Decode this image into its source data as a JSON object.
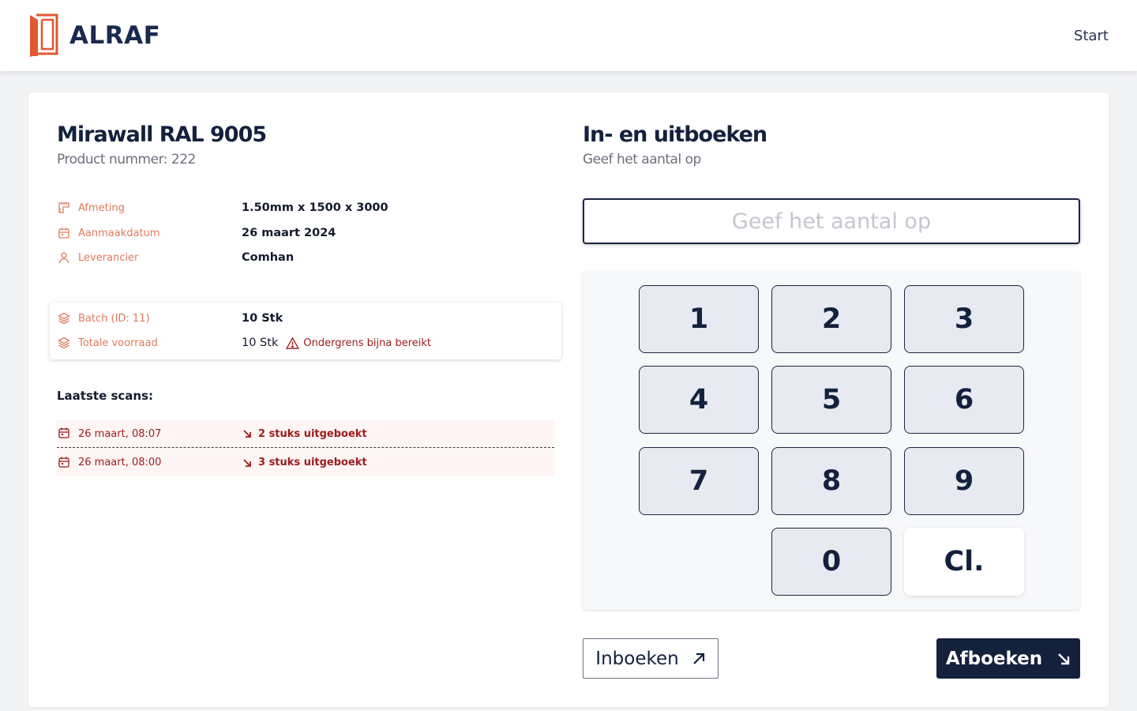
{
  "header": {
    "brand_name": "ALRAF",
    "nav_start": "Start",
    "accent_color": "#e0582f"
  },
  "product": {
    "title": "Mirawall RAL 9005",
    "subtitle": "Product nummer: 222",
    "specs": [
      {
        "icon": "ruler-icon",
        "label": "Afmeting",
        "value": "1.50mm x 1500 x 3000"
      },
      {
        "icon": "calendar-icon",
        "label": "Aanmaakdatum",
        "value": "26 maart 2024"
      },
      {
        "icon": "user-icon",
        "label": "Leverancier",
        "value": "Comhan"
      }
    ],
    "batch": {
      "label": "Batch (ID: 11)",
      "value": "10 Stk",
      "total_label": "Totale voorraad",
      "total_value": "10 Stk",
      "warning": "Ondergrens bijna bereikt"
    },
    "scans_title": "Laatste scans:",
    "scans": [
      {
        "date": "26 maart, 08:07",
        "action": "2 stuks uitgeboekt"
      },
      {
        "date": "26 maart, 08:00",
        "action": "3 stuks uitgeboekt"
      }
    ]
  },
  "booking": {
    "title": "In- en uitboeken",
    "subtitle": "Geef het aantal op",
    "input_placeholder": "Geef het aantal op",
    "input_value": "",
    "keys": [
      "1",
      "2",
      "3",
      "4",
      "5",
      "6",
      "7",
      "8",
      "9",
      "0"
    ],
    "clear_label": "Cl.",
    "inboeken_label": "Inboeken",
    "afboeken_label": "Afboeken"
  }
}
